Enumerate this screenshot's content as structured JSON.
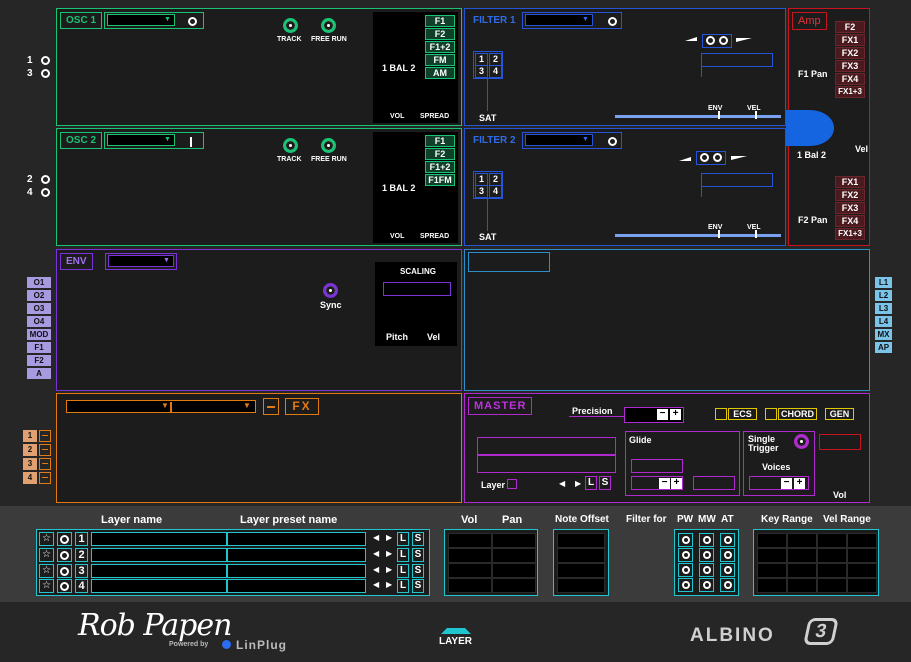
{
  "side_numbers": {
    "osc1": [
      "1",
      "3"
    ],
    "osc2": [
      "2",
      "4"
    ]
  },
  "osc1": {
    "title": "OSC 1",
    "track": "TRACK",
    "free_run": "FREE RUN",
    "bal": "1 BAL 2",
    "vol": "VOL",
    "spread": "SPREAD",
    "buttons": [
      "F1",
      "F2",
      "F1+2",
      "FM",
      "AM"
    ]
  },
  "osc2": {
    "title": "OSC 2",
    "track": "TRACK",
    "free_run": "FREE RUN",
    "bal": "1 BAL 2",
    "vol": "VOL",
    "spread": "SPREAD",
    "buttons": [
      "F1",
      "F2",
      "F1+2",
      "F1FM"
    ]
  },
  "filter1": {
    "title": "FILTER 1",
    "sat": "SAT",
    "env": "ENV",
    "vel": "VEL",
    "routing": [
      "1",
      "2",
      "3",
      "4"
    ]
  },
  "filter2": {
    "title": "FILTER 2",
    "sat": "SAT",
    "env": "ENV",
    "vel": "VEL",
    "routing": [
      "1",
      "2",
      "3",
      "4"
    ]
  },
  "amp": {
    "title": "Amp",
    "f1_pan": "F1 Pan",
    "f2_pan": "F2 Pan",
    "bal": "1 Bal 2",
    "vel": "Vel",
    "top_buttons": [
      "F2",
      "FX1",
      "FX2",
      "FX3",
      "FX4",
      "FX1+3"
    ],
    "bottom_buttons": [
      "FX1",
      "FX2",
      "FX3",
      "FX4",
      "FX1+3"
    ]
  },
  "env": {
    "title": "ENV",
    "sync": "Sync",
    "scaling": "SCALING",
    "pitch": "Pitch",
    "vel": "Vel",
    "sources": [
      "O1",
      "O2",
      "O3",
      "O4",
      "MOD",
      "F1",
      "F2",
      "A"
    ]
  },
  "lfo": {
    "sources": [
      "L1",
      "L2",
      "L3",
      "L4",
      "MX",
      "AP"
    ]
  },
  "fx": {
    "label": "FX",
    "minus": "—",
    "slots": [
      "1",
      "2",
      "3",
      "4"
    ]
  },
  "master": {
    "title": "MASTER",
    "precision": "Precision",
    "ecs": "ECS",
    "chord": "CHORD",
    "gen": "GEN",
    "glide": "Glide",
    "single_trigger": "Single Trigger",
    "voices": "Voices",
    "layer": "Layer",
    "vol": "Vol",
    "l": "L",
    "s": "S",
    "minus": "−",
    "plus": "+"
  },
  "layers": {
    "col_layer_name": "Layer name",
    "col_preset": "Layer preset name",
    "col_vol": "Vol",
    "col_pan": "Pan",
    "col_note_offset": "Note Offset",
    "col_filter_for": "Filter for",
    "col_pw": "PW",
    "col_mw": "MW",
    "col_at": "AT",
    "col_key_range": "Key Range",
    "col_vel_range": "Vel Range",
    "rows": [
      "1",
      "2",
      "3",
      "4"
    ],
    "l": "L",
    "s": "S"
  },
  "footer": {
    "brand": "Rob Papen",
    "powered": "Powered by",
    "linplug": "LinPlug",
    "layer_tab": "LAYER",
    "product": "ALBINO",
    "version": "3"
  },
  "colors": {
    "osc": "#19c373",
    "filter": "#2554d8",
    "amp": "#c8141e",
    "env": "#7b32d8",
    "lfo": "#2c8fc9",
    "fx": "#e27a13",
    "master": "#b02ad0",
    "layer": "#1fc6d0"
  }
}
